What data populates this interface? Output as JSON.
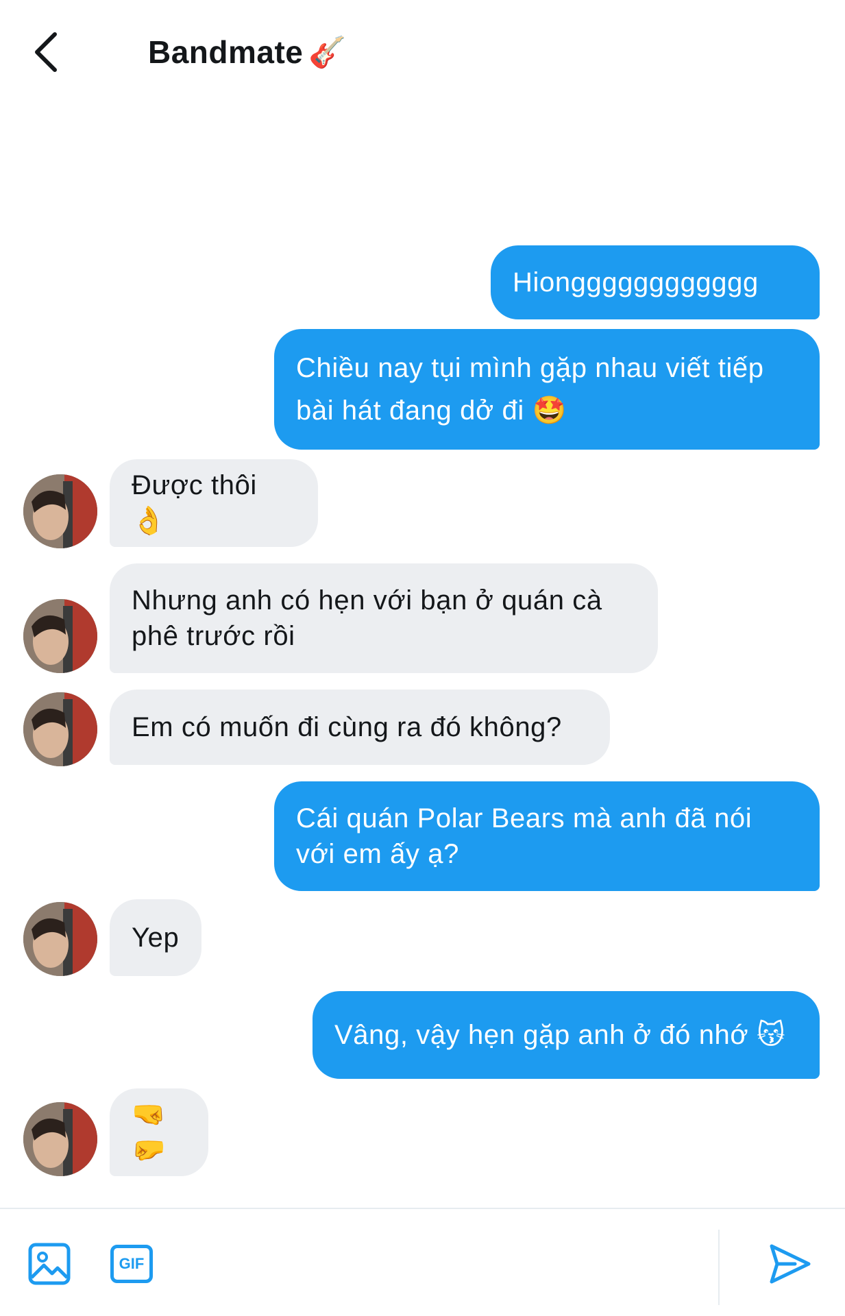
{
  "header": {
    "title": "Bandmate",
    "title_emoji": "🎸"
  },
  "messages": [
    {
      "from": "me",
      "text": "Hiongggggggggggg"
    },
    {
      "from": "me",
      "text": "Chiều nay tụi mình gặp nhau viết tiếp\nbài hát đang dở đi 🤩"
    },
    {
      "from": "them",
      "text": "Được thôi 👌"
    },
    {
      "from": "them",
      "text": "Nhưng anh có hẹn với bạn ở quán cà\nphê trước rồi"
    },
    {
      "from": "them",
      "text": "Em có muốn đi cùng ra đó không?"
    },
    {
      "from": "me",
      "text": "Cái quán Polar Bears mà anh đã nói\nvới em ấy ạ?"
    },
    {
      "from": "them",
      "text": "Yep"
    },
    {
      "from": "me",
      "text": "Vâng, vậy hẹn gặp anh ở đó nhớ 😽"
    },
    {
      "from": "them",
      "text": "🤜🤛"
    }
  ],
  "composer": {
    "gif_label": "GIF"
  },
  "colors": {
    "accent": "#1d9bf0",
    "received_bubble": "#eceef1"
  }
}
